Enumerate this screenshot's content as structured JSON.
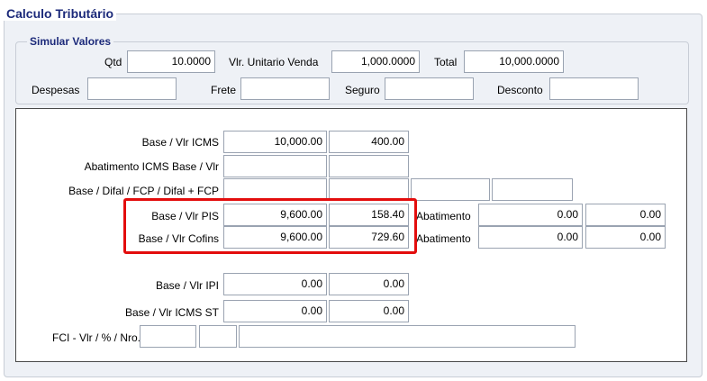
{
  "outer": {
    "title": "Calculo Tributário"
  },
  "simular": {
    "title": "Simular Valores",
    "qtd_label": "Qtd",
    "qtd_value": "10.0000",
    "vlr_unit_label": "Vlr. Unitario Venda",
    "vlr_unit_value": "1,000.0000",
    "total_label": "Total",
    "total_value": "10,000.0000",
    "despesas_label": "Despesas",
    "despesas_value": "",
    "frete_label": "Frete",
    "frete_value": "",
    "seguro_label": "Seguro",
    "seguro_value": "",
    "desconto_label": "Desconto",
    "desconto_value": ""
  },
  "rows": {
    "icms": {
      "label": "Base / Vlr ICMS",
      "base": "10,000.00",
      "valor": "400.00"
    },
    "abat_icms": {
      "label": "Abatimento ICMS Base  / Vlr",
      "base": "",
      "valor": ""
    },
    "difal": {
      "label": "Base / Difal / FCP / Difal + FCP",
      "base": "",
      "difal": "",
      "fcp": "",
      "difal_fcp": ""
    },
    "pis": {
      "label": "Base / Vlr PIS",
      "base": "9,600.00",
      "valor": "158.40",
      "abat_label": "Abatimento",
      "abat_base": "0.00",
      "abat_valor": "0.00"
    },
    "cofins": {
      "label": "Base / Vlr Cofins",
      "base": "9,600.00",
      "valor": "729.60",
      "abat_label": "Abatimento",
      "abat_base": "0.00",
      "abat_valor": "0.00"
    },
    "ipi": {
      "label": "Base / Vlr IPI",
      "base": "0.00",
      "valor": "0.00"
    },
    "icms_st": {
      "label": "Base / Vlr ICMS ST",
      "base": "0.00",
      "valor": "0.00"
    },
    "fci": {
      "label": "FCI - Vlr / % / Nro.",
      "vlr": "",
      "pct": "",
      "nro": ""
    }
  },
  "colors": {
    "legend": "#1c2a7a",
    "highlight": "#e30d0d",
    "panel": "#eef1f6"
  }
}
